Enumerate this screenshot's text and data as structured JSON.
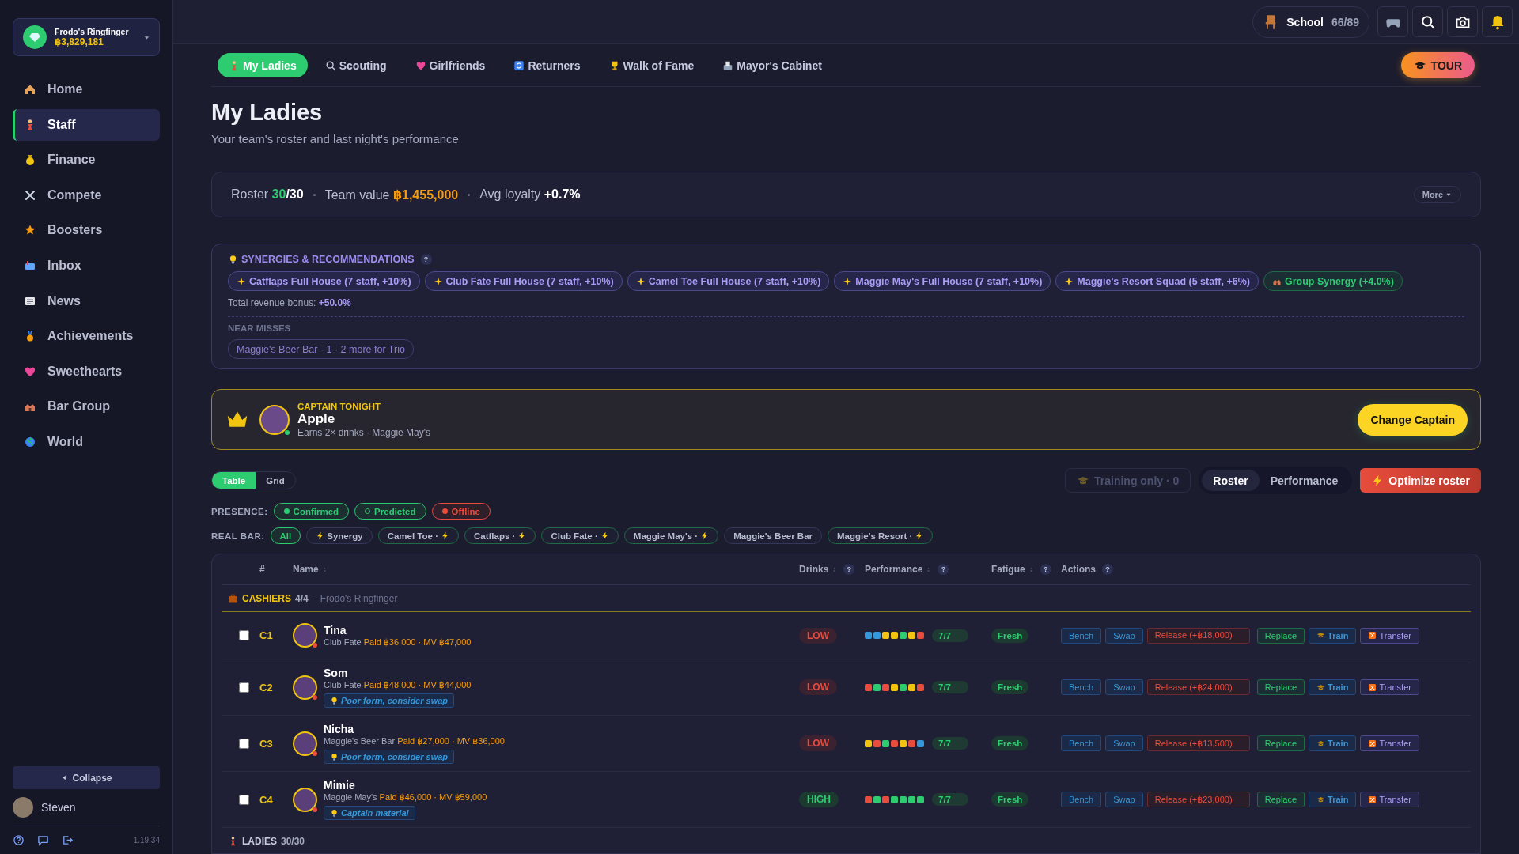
{
  "account": {
    "name": "Frodo's Ringfinger",
    "balance": "฿3,829,181"
  },
  "sidebar": {
    "items": [
      {
        "label": "Home",
        "selected": false
      },
      {
        "label": "Staff",
        "selected": true
      },
      {
        "label": "Finance",
        "selected": false
      },
      {
        "label": "Compete",
        "selected": false
      },
      {
        "label": "Boosters",
        "selected": false
      },
      {
        "label": "Inbox",
        "selected": false
      },
      {
        "label": "News",
        "selected": false
      },
      {
        "label": "Achievements",
        "selected": false
      },
      {
        "label": "Sweethearts",
        "selected": false
      },
      {
        "label": "Bar Group",
        "selected": false
      },
      {
        "label": "World",
        "selected": false
      }
    ],
    "collapse": "Collapse",
    "user": "Steven",
    "version": "1.19.34"
  },
  "top_bar": {
    "school_label": "School",
    "school_count": "66/89"
  },
  "tabs": [
    {
      "label": "My Ladies",
      "selected": true
    },
    {
      "label": "Scouting",
      "selected": false
    },
    {
      "label": "Girlfriends",
      "selected": false
    },
    {
      "label": "Returners",
      "selected": false
    },
    {
      "label": "Walk of Fame",
      "selected": false
    },
    {
      "label": "Mayor's Cabinet",
      "selected": false
    }
  ],
  "tour": "TOUR",
  "page": {
    "title": "My Ladies",
    "subtitle": "Your team's roster and last night's performance"
  },
  "summary": {
    "roster_label": "Roster",
    "roster_count": "30",
    "roster_total": "/30",
    "team_value_label": "Team value",
    "team_value": "฿1,455,000",
    "loyalty_label": "Avg loyalty",
    "loyalty": "+0.7%",
    "more": "More"
  },
  "synergies": {
    "title": "SYNERGIES & RECOMMENDATIONS",
    "help": "?",
    "chips": [
      {
        "label": "Catflaps Full House (7 staff, +10%)",
        "kind": "staff"
      },
      {
        "label": "Club Fate Full House (7 staff, +10%)",
        "kind": "staff"
      },
      {
        "label": "Camel Toe Full House (7 staff, +10%)",
        "kind": "staff"
      },
      {
        "label": "Maggie May's Full House (7 staff, +10%)",
        "kind": "staff"
      },
      {
        "label": "Maggie's Resort Squad (5 staff, +6%)",
        "kind": "staff"
      },
      {
        "label": "Group Synergy (+4.0%)",
        "kind": "group"
      }
    ],
    "bonus_label": "Total revenue bonus:",
    "bonus": "+50.0%",
    "near_misses_title": "NEAR MISSES",
    "near_misses": [
      "Maggie's Beer Bar · 1 · 2 more for Trio"
    ]
  },
  "captain": {
    "heading": "CAPTAIN TONIGHT",
    "name": "Apple",
    "detail": "Earns 2× drinks · Maggie May's",
    "status": {
      "color": "#2ecc71"
    },
    "button": "Change Captain"
  },
  "view_toggle": [
    {
      "label": "Table",
      "selected": true
    },
    {
      "label": "Grid",
      "selected": false
    }
  ],
  "training": {
    "label": "Training only · 0",
    "disabled": true
  },
  "mode_toggle": [
    {
      "label": "Roster",
      "selected": true
    },
    {
      "label": "Performance",
      "selected": false
    }
  ],
  "optimize": "Optimize roster",
  "presence": {
    "label": "PRESENCE:",
    "options": [
      {
        "label": "Confirmed",
        "kind": "confirmed"
      },
      {
        "label": "Predicted",
        "kind": "predicted"
      },
      {
        "label": "Offline",
        "kind": "offline"
      }
    ]
  },
  "real_bar": {
    "label": "REAL BAR:",
    "options": [
      {
        "label": "All",
        "kind": "all",
        "selected": true,
        "bolt": false
      },
      {
        "label": "Synergy",
        "kind": "synergy",
        "selected": false,
        "bolt": true
      },
      {
        "label": "Camel Toe ·",
        "kind": "bar",
        "selected": false,
        "bolt": true
      },
      {
        "label": "Catflaps ·",
        "kind": "bar",
        "selected": false,
        "bolt": true
      },
      {
        "label": "Club Fate ·",
        "kind": "bar",
        "selected": false,
        "bolt": true
      },
      {
        "label": "Maggie May's ·",
        "kind": "bar",
        "selected": false,
        "bolt": true
      },
      {
        "label": "Maggie's Beer Bar",
        "kind": "bar",
        "selected": false,
        "bolt": false
      },
      {
        "label": "Maggie's Resort ·",
        "kind": "bar",
        "selected": false,
        "bolt": true
      }
    ]
  },
  "table": {
    "columns": [
      {
        "label": "#",
        "sortable": false
      },
      {
        "label": "Name",
        "sortable": true
      },
      {
        "label": "Drinks",
        "sortable": true,
        "help": "?"
      },
      {
        "label": "Performance",
        "sortable": true,
        "help": "?"
      },
      {
        "label": "Fatigue",
        "sortable": true,
        "help": "?"
      },
      {
        "label": "Actions",
        "sortable": false,
        "help": "?"
      }
    ],
    "groups": [
      {
        "kind": "cashiers",
        "title": "CASHIERS",
        "count": "4/4",
        "note": "– Frodo's Ringfinger",
        "rows": [
          {
            "checked": false,
            "slot": "C1",
            "name": "Tina",
            "bar": "Club Fate",
            "paid": "Paid ฿36,000 · MV ฿47,000",
            "status": {
              "color": "#e74c3c"
            },
            "drinks": {
              "label": "LOW",
              "kind": "low"
            },
            "nights": [
              {
                "color": "#3498db"
              },
              {
                "color": "#3498db"
              },
              {
                "color": "#f1c40f"
              },
              {
                "color": "#f1c40f"
              },
              {
                "color": "#2ecc71"
              },
              {
                "color": "#f1c40f"
              },
              {
                "color": "#e74c3c"
              }
            ],
            "score": "7/7",
            "fatigue": "Fresh",
            "actions": [
              {
                "label": "Bench",
                "kind": "bench"
              },
              {
                "label": "Swap",
                "kind": "swap"
              },
              {
                "label": "Release (+฿18,000)",
                "kind": "release"
              },
              {
                "label": "Replace",
                "kind": "replace"
              },
              {
                "label": "Train",
                "kind": "train"
              },
              {
                "label": "Transfer",
                "kind": "transfer"
              }
            ]
          },
          {
            "checked": false,
            "slot": "C2",
            "name": "Som",
            "bar": "Club Fate",
            "paid": "Paid ฿48,000 · MV ฿44,000",
            "status": {
              "color": "#e74c3c"
            },
            "tip": "Poor form, consider swap",
            "drinks": {
              "label": "LOW",
              "kind": "low"
            },
            "nights": [
              {
                "color": "#e74c3c"
              },
              {
                "color": "#2ecc71"
              },
              {
                "color": "#e74c3c"
              },
              {
                "color": "#f1c40f"
              },
              {
                "color": "#2ecc71"
              },
              {
                "color": "#f1c40f"
              },
              {
                "color": "#e74c3c"
              }
            ],
            "score": "7/7",
            "fatigue": "Fresh",
            "actions": [
              {
                "label": "Bench",
                "kind": "bench"
              },
              {
                "label": "Swap",
                "kind": "swap"
              },
              {
                "label": "Release (+฿24,000)",
                "kind": "release"
              },
              {
                "label": "Replace",
                "kind": "replace"
              },
              {
                "label": "Train",
                "kind": "train"
              },
              {
                "label": "Transfer",
                "kind": "transfer"
              }
            ]
          },
          {
            "checked": false,
            "slot": "C3",
            "name": "Nicha",
            "bar": "Maggie's Beer Bar",
            "paid": "Paid ฿27,000 · MV ฿36,000",
            "status": {
              "color": "#e74c3c"
            },
            "tip": "Poor form, consider swap",
            "drinks": {
              "label": "LOW",
              "kind": "low"
            },
            "nights": [
              {
                "color": "#f1c40f"
              },
              {
                "color": "#e74c3c"
              },
              {
                "color": "#2ecc71"
              },
              {
                "color": "#e74c3c"
              },
              {
                "color": "#f1c40f"
              },
              {
                "color": "#e74c3c"
              },
              {
                "color": "#3498db"
              }
            ],
            "score": "7/7",
            "fatigue": "Fresh",
            "actions": [
              {
                "label": "Bench",
                "kind": "bench"
              },
              {
                "label": "Swap",
                "kind": "swap"
              },
              {
                "label": "Release (+฿13,500)",
                "kind": "release"
              },
              {
                "label": "Replace",
                "kind": "replace"
              },
              {
                "label": "Train",
                "kind": "train"
              },
              {
                "label": "Transfer",
                "kind": "transfer"
              }
            ]
          },
          {
            "checked": false,
            "slot": "C4",
            "name": "Mimie",
            "bar": "Maggie May's",
            "paid": "Paid ฿46,000 · MV ฿59,000",
            "status": {
              "color": "#e74c3c"
            },
            "tip": "Captain material",
            "drinks": {
              "label": "HIGH",
              "kind": "high"
            },
            "nights": [
              {
                "color": "#e74c3c"
              },
              {
                "color": "#2ecc71"
              },
              {
                "color": "#e74c3c"
              },
              {
                "color": "#2ecc71"
              },
              {
                "color": "#2ecc71"
              },
              {
                "color": "#2ecc71"
              },
              {
                "color": "#2ecc71"
              }
            ],
            "score": "7/7",
            "fatigue": "Fresh",
            "actions": [
              {
                "label": "Bench",
                "kind": "bench"
              },
              {
                "label": "Swap",
                "kind": "swap"
              },
              {
                "label": "Release (+฿23,000)",
                "kind": "release"
              },
              {
                "label": "Replace",
                "kind": "replace"
              },
              {
                "label": "Train",
                "kind": "train"
              },
              {
                "label": "Transfer",
                "kind": "transfer"
              }
            ]
          }
        ]
      },
      {
        "kind": "ladies",
        "title": "LADIES",
        "count": "30/30"
      }
    ]
  }
}
